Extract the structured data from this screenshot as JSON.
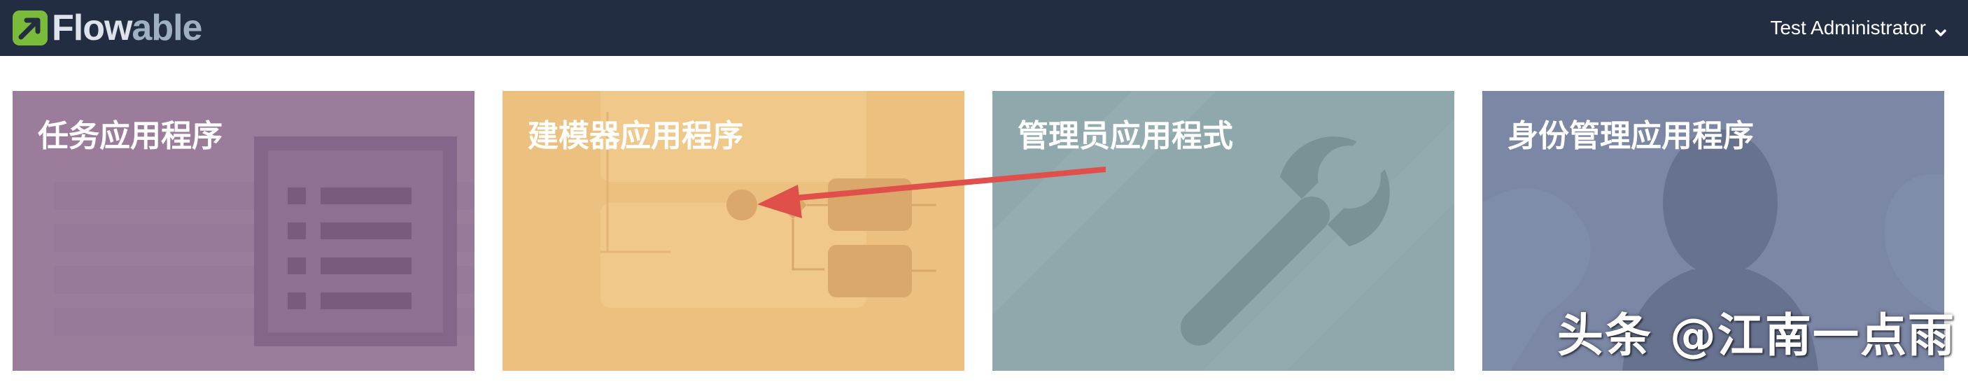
{
  "header": {
    "logo_text_main": "Flow",
    "logo_text_accent": "able",
    "user_name": "Test Administrator",
    "colors": {
      "background": "#232d42",
      "logo_green": "#7bbb3a"
    }
  },
  "tiles": [
    {
      "label": "任务应用程序",
      "color": "#9b7d9b",
      "icon": "list-document-icon"
    },
    {
      "label": "建模器应用程序",
      "color": "#ecc07f",
      "icon": "process-diagram-icon"
    },
    {
      "label": "管理员应用程式",
      "color": "#8fa8ab",
      "icon": "wrench-icon"
    },
    {
      "label": "身份管理应用程序",
      "color": "#7b87a5",
      "icon": "person-silhouette-icon"
    }
  ],
  "annotation_arrow_color": "#e0504a",
  "watermark": "头条 @江南一点雨"
}
